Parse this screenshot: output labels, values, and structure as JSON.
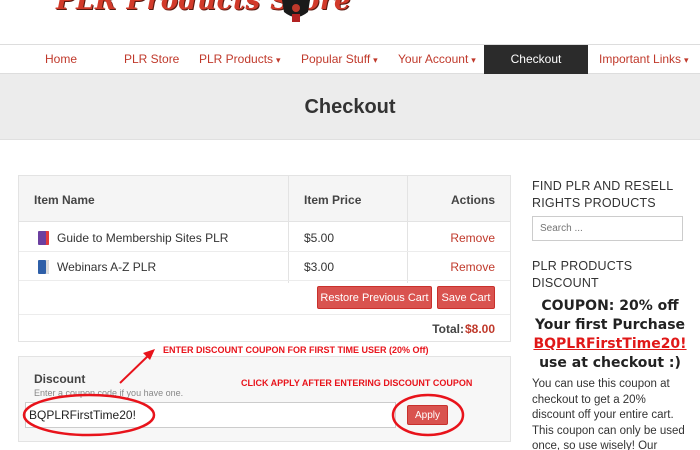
{
  "header": {
    "logo_text": "PLR Products Store"
  },
  "nav": {
    "items": [
      {
        "label": "Home",
        "caret": false
      },
      {
        "label": "PLR Store",
        "caret": false
      },
      {
        "label": "PLR Products",
        "caret": true
      },
      {
        "label": "Popular Stuff",
        "caret": true
      },
      {
        "label": "Your Account",
        "caret": true
      },
      {
        "label": "Checkout",
        "caret": false,
        "active": true
      },
      {
        "label": "Important Links",
        "caret": true
      }
    ],
    "caret_glyph": "▾"
  },
  "page": {
    "title": "Checkout"
  },
  "cart": {
    "headers": {
      "name": "Item Name",
      "price": "Item Price",
      "actions": "Actions"
    },
    "items": [
      {
        "name": "Guide to Membership Sites PLR",
        "price": "$5.00",
        "action": "Remove",
        "icon": "book-icon",
        "icon_color": "#6b3fa0"
      },
      {
        "name": "Webinars A-Z PLR",
        "price": "$3.00",
        "action": "Remove",
        "icon": "book-icon",
        "icon_color": "#2e5fa8"
      }
    ],
    "restore_label": "Restore Previous Cart",
    "save_label": "Save Cart",
    "total_label": "Total:",
    "total_value": "$8.00"
  },
  "discount": {
    "title": "Discount",
    "help": "Enter a coupon code if you have one.",
    "coupon_value": "BQPLRFirstTime20!",
    "apply_label": "Apply"
  },
  "annotations": {
    "coupon_note": "ENTER DISCOUNT COUPON FOR FIRST TIME USER (20% Off)",
    "apply_note": "CLICK APPLY AFTER ENTERING DISCOUNT COUPON"
  },
  "sidebar": {
    "find_heading_1": "FIND PLR AND RESELL",
    "find_heading_2": "RIGHTS PRODUCTS",
    "search_placeholder": "Search ...",
    "discount_heading_1": "PLR PRODUCTS",
    "discount_heading_2": "DISCOUNT",
    "promo": {
      "line1": "COUPON:  20% off",
      "line2": "Your first Purchase",
      "line3": "BQPLRFirstTime20!",
      "line4": "use at checkout :)"
    },
    "text": "You can use this coupon at checkout to get a 20% discount off your entire cart. This coupon can only be used once, so use wisely! Our subscribers get"
  },
  "colors": {
    "accent": "#c0392b",
    "button": "#d9534f",
    "annotation": "#e8131b",
    "nav_active": "#2b2b2b"
  }
}
